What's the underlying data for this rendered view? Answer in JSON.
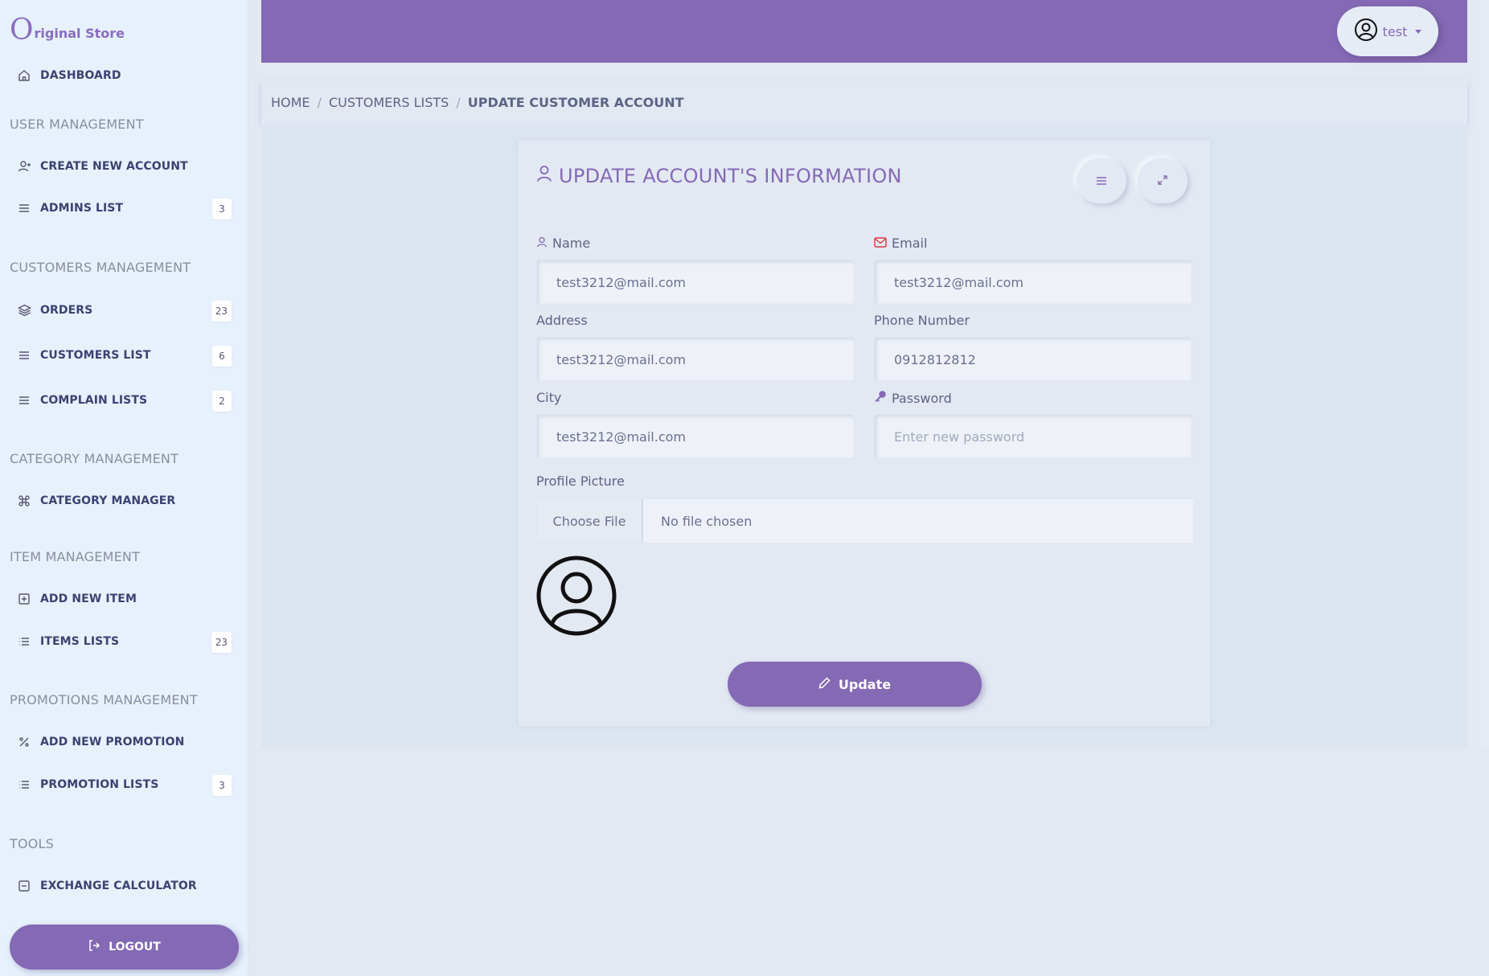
{
  "brand": {
    "logo_letter": "O",
    "name": "riginal Store"
  },
  "sidebar": {
    "dashboard": "DASHBOARD",
    "sections": {
      "user": "USER MANAGEMENT",
      "customers": "CUSTOMERS MANAGEMENT",
      "category": "CATEGORY MANAGEMENT",
      "item": "ITEM MANAGEMENT",
      "promotions": "PROMOTIONS MANAGEMENT",
      "tools": "TOOLS"
    },
    "items": {
      "create_account": {
        "label": "CREATE NEW ACCOUNT",
        "icon": "user-plus-icon"
      },
      "admins_list": {
        "label": "ADMINS LIST",
        "badge": "3",
        "icon": "list-icon"
      },
      "orders": {
        "label": "ORDERS",
        "badge": "23",
        "icon": "layers-icon"
      },
      "customers_list": {
        "label": "CUSTOMERS LIST",
        "badge": "6",
        "icon": "list-icon"
      },
      "complain_lists": {
        "label": "COMPLAIN LISTS",
        "badge": "2",
        "icon": "list-icon"
      },
      "category_manager": {
        "label": "CATEGORY MANAGER",
        "icon": "command-icon"
      },
      "add_item": {
        "label": "ADD NEW ITEM",
        "icon": "plus-square-icon"
      },
      "items_lists": {
        "label": "ITEMS LISTS",
        "badge": "23",
        "icon": "list-bullets-icon"
      },
      "add_promotion": {
        "label": "ADD NEW PROMOTION",
        "icon": "percent-icon"
      },
      "promotion_lists": {
        "label": "PROMOTION LISTS",
        "badge": "3",
        "icon": "list-bullets-icon"
      },
      "exchange_calculator": {
        "label": "EXCHANGE CALCULATOR",
        "icon": "minus-square-icon"
      }
    },
    "logout": "LOGOUT"
  },
  "header": {
    "username": "test"
  },
  "breadcrumb": {
    "home": "HOME",
    "customers": "CUSTOMERS LISTS",
    "current": "UPDATE CUSTOMER ACCOUNT",
    "separator": "/"
  },
  "form": {
    "title": "UPDATE ACCOUNT'S INFORMATION",
    "fields": {
      "name": {
        "label": "Name",
        "value": "test3212@mail.com"
      },
      "email": {
        "label": "Email",
        "value": "test3212@mail.com"
      },
      "address": {
        "label": "Address",
        "value": "test3212@mail.com"
      },
      "phone": {
        "label": "Phone Number",
        "value": "0912812812"
      },
      "city": {
        "label": "City",
        "value": "test3212@mail.com"
      },
      "password": {
        "label": "Password",
        "placeholder": "Enter new password"
      }
    },
    "profile_picture": {
      "label": "Profile Picture",
      "button": "Choose File",
      "status": "No file chosen"
    },
    "submit": "Update"
  },
  "colors": {
    "accent": "#8469b4",
    "sidebar_bg": "#e6f1fc",
    "page_bg": "#e3e9f3",
    "email_icon": "#d9363e"
  }
}
